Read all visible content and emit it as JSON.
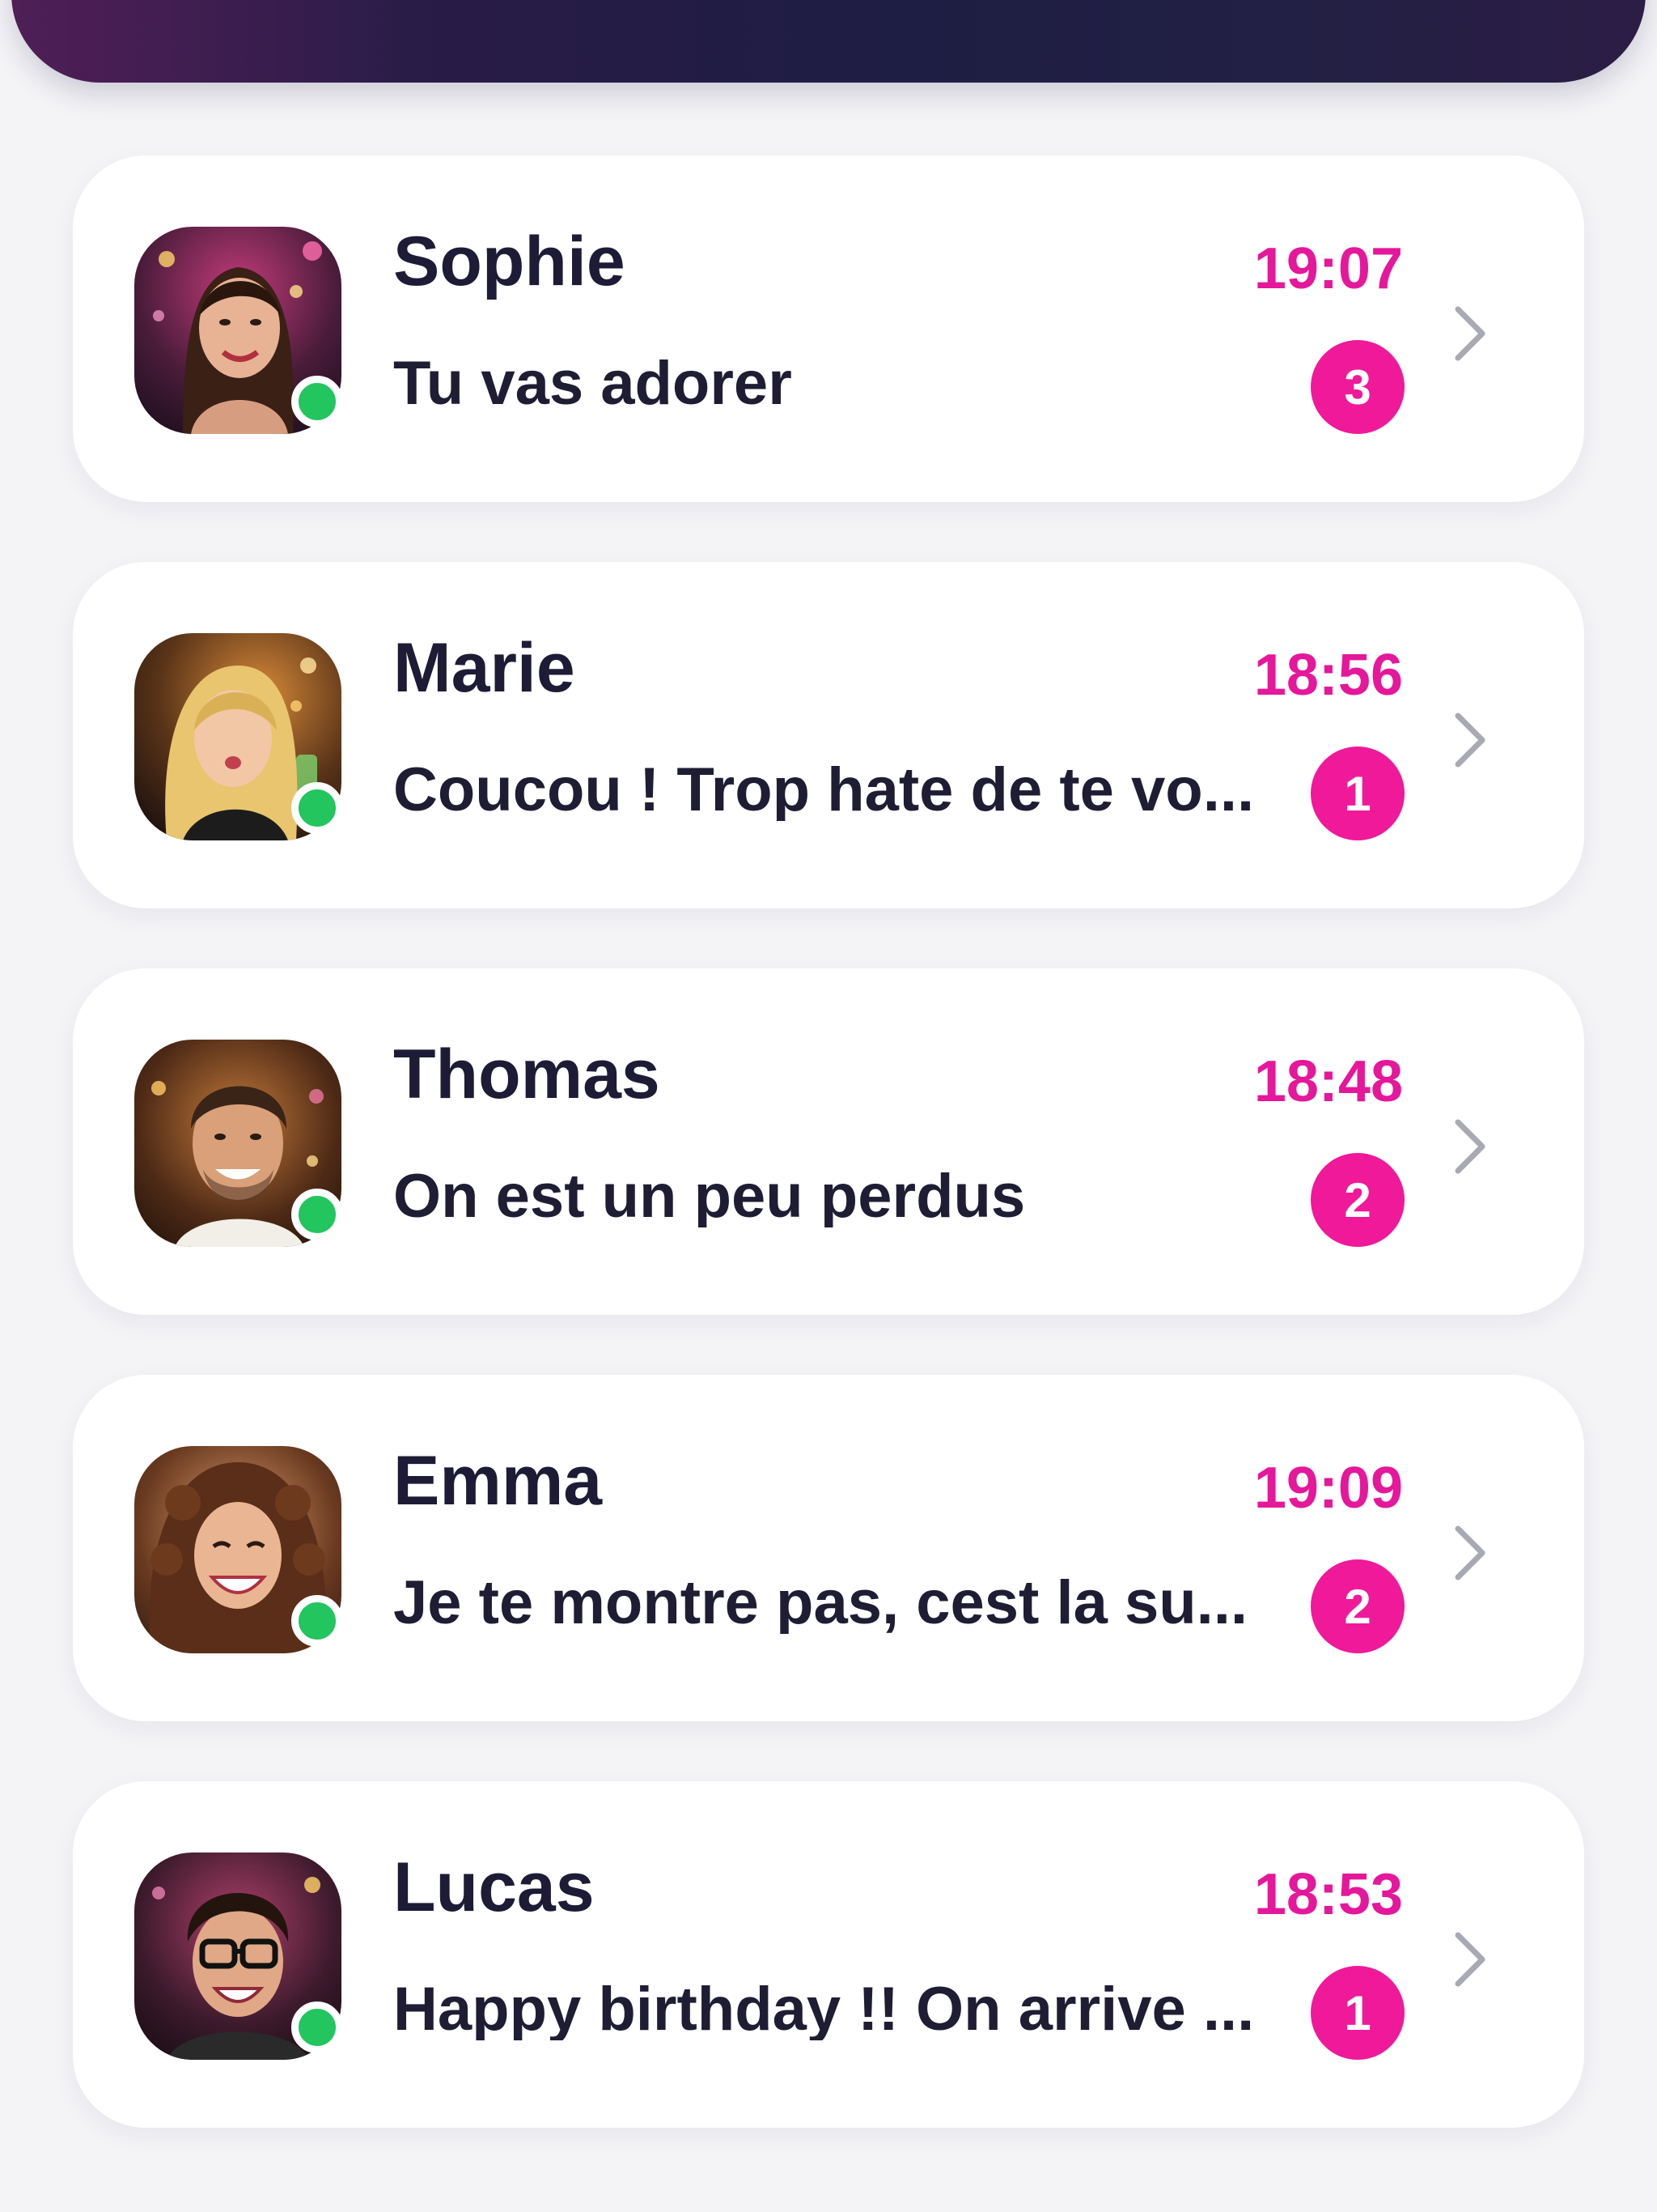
{
  "colors": {
    "accent": "#e5179a",
    "badge": "#f0199a",
    "online": "#22c55e",
    "text": "#1d1b35",
    "background": "#f4f4f7",
    "card": "#ffffff",
    "header": "#1e1d43"
  },
  "conversations": [
    {
      "name": "Sophie",
      "message": "Tu vas adorer",
      "time": "19:07",
      "unread": "3",
      "online": true,
      "icon": "chevron-right-icon"
    },
    {
      "name": "Marie",
      "message": "Coucou ! Trop hate de te vo...",
      "time": "18:56",
      "unread": "1",
      "online": true,
      "icon": "chevron-right-icon"
    },
    {
      "name": "Thomas",
      "message": "On est un peu perdus",
      "time": "18:48",
      "unread": "2",
      "online": true,
      "icon": "chevron-right-icon"
    },
    {
      "name": "Emma",
      "message": "Je te montre pas, cest la su...",
      "time": "19:09",
      "unread": "2",
      "online": true,
      "icon": "chevron-right-icon"
    },
    {
      "name": "Lucas",
      "message": "Happy birthday !! On arrive ...",
      "time": "18:53",
      "unread": "1",
      "online": true,
      "icon": "chevron-right-icon"
    }
  ]
}
